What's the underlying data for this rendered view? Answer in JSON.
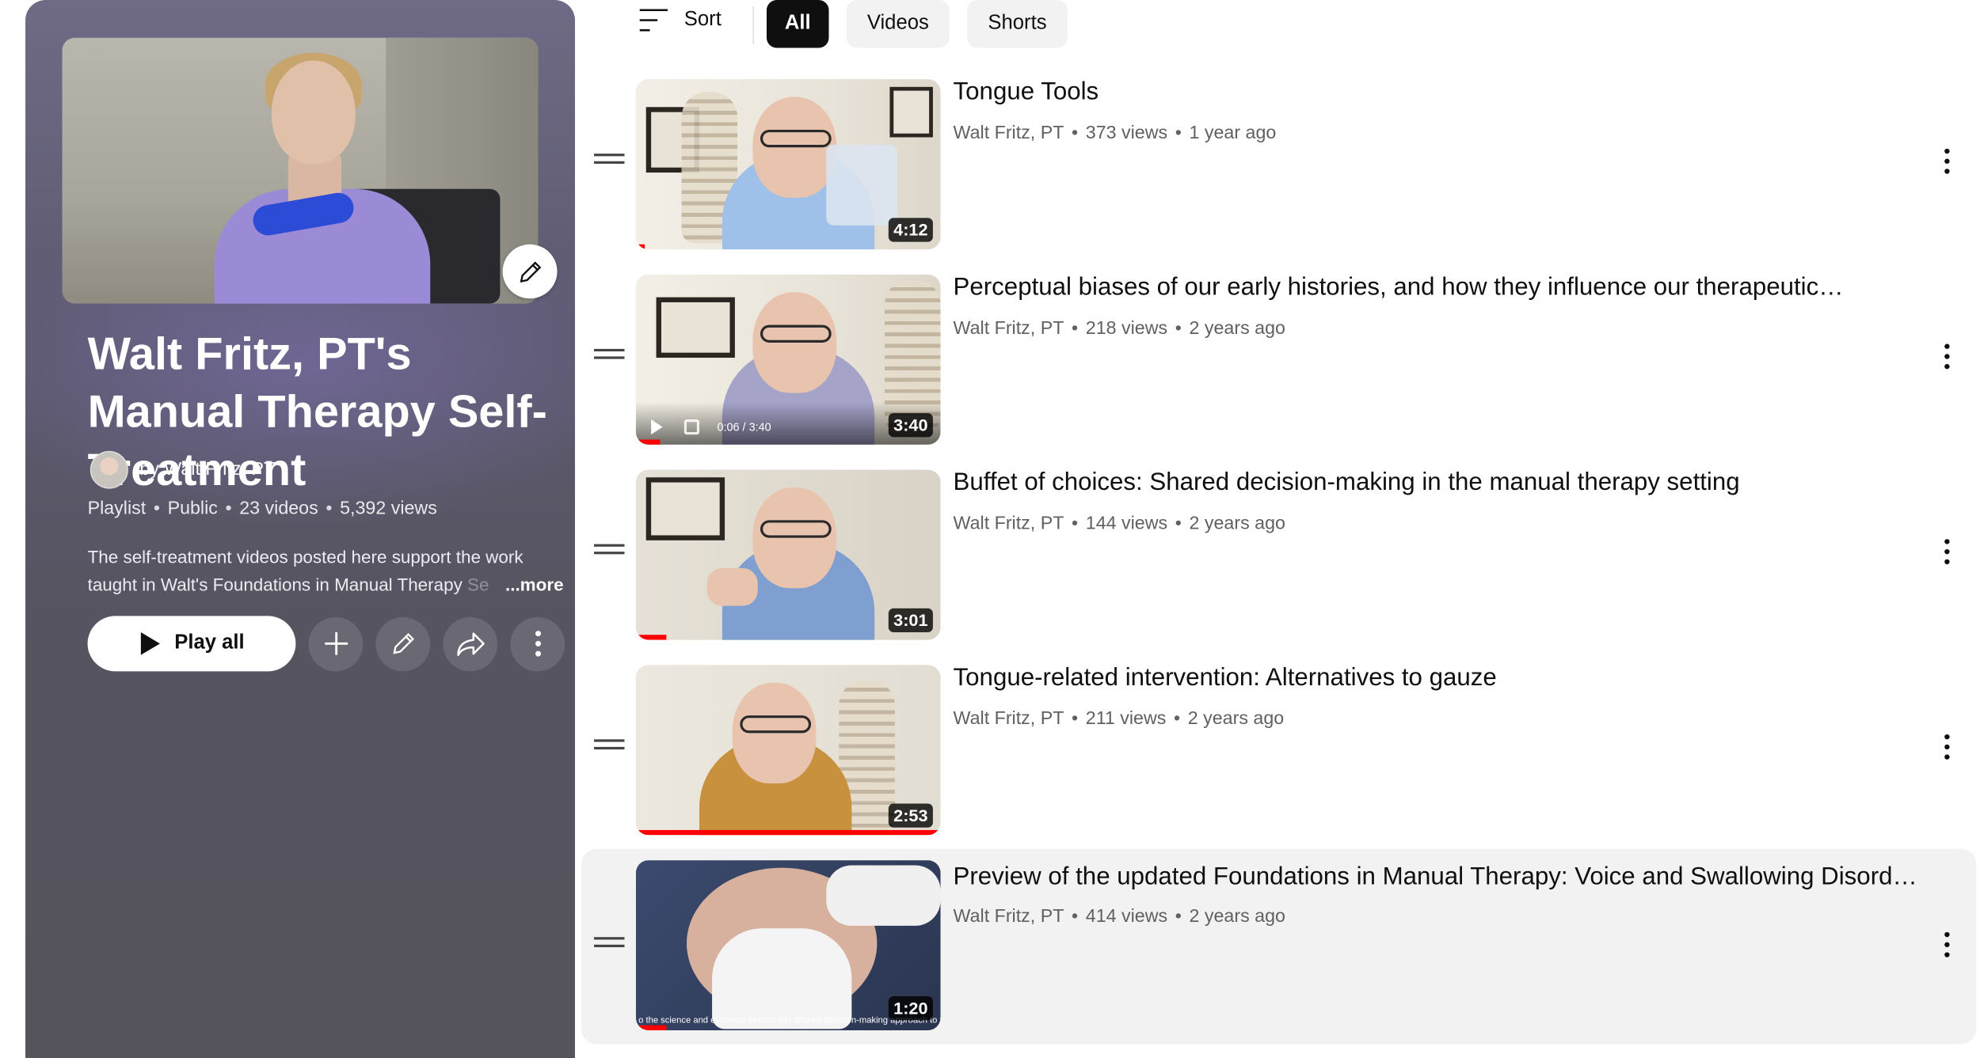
{
  "filters": {
    "sort_label": "Sort",
    "chips": [
      {
        "label": "All",
        "active": true
      },
      {
        "label": "Videos",
        "active": false
      },
      {
        "label": "Shorts",
        "active": false
      }
    ]
  },
  "playlist": {
    "title": "Walt Fritz, PT's Manual Therapy Self-Treatment",
    "owner": "by Walt Fritz, PT",
    "meta": [
      "Playlist",
      "Public",
      "23 videos",
      "5,392 views"
    ],
    "description_line1": "The self-treatment videos posted here support the work",
    "description_line2": "taught in Walt's Foundations in Manual Therapy Se",
    "more_label": "...more",
    "play_all_label": "Play all",
    "accent_color": "#6f6b86"
  },
  "videos": [
    {
      "title": "Tongue Tools",
      "channel": "Walt Fritz, PT",
      "views": "373 views",
      "age": "1 year ago",
      "duration": "4:12",
      "watched_fraction": 0.03
    },
    {
      "title": "Perceptual biases of our early histories, and how they influence our therapeutic…",
      "channel": "Walt Fritz, PT",
      "views": "218 views",
      "age": "2 years ago",
      "duration": "3:40",
      "watched_fraction": 0.08,
      "player_time": "0:06 / 3:40"
    },
    {
      "title": "Buffet of choices: Shared decision-making in the manual therapy setting",
      "channel": "Walt Fritz, PT",
      "views": "144 views",
      "age": "2 years ago",
      "duration": "3:01",
      "watched_fraction": 0.1
    },
    {
      "title": "Tongue-related intervention: Alternatives to gauze",
      "channel": "Walt Fritz, PT",
      "views": "211 views",
      "age": "2 years ago",
      "duration": "2:53",
      "watched_fraction": 1.0
    },
    {
      "title": "Preview of the updated Foundations in Manual Therapy: Voice and Swallowing Disorde…",
      "channel": "Walt Fritz, PT",
      "views": "414 views",
      "age": "2 years ago",
      "duration": "1:20",
      "watched_fraction": 0.1,
      "caption": "o the science and evidence behind this shared decision-making approach to therapy"
    }
  ]
}
